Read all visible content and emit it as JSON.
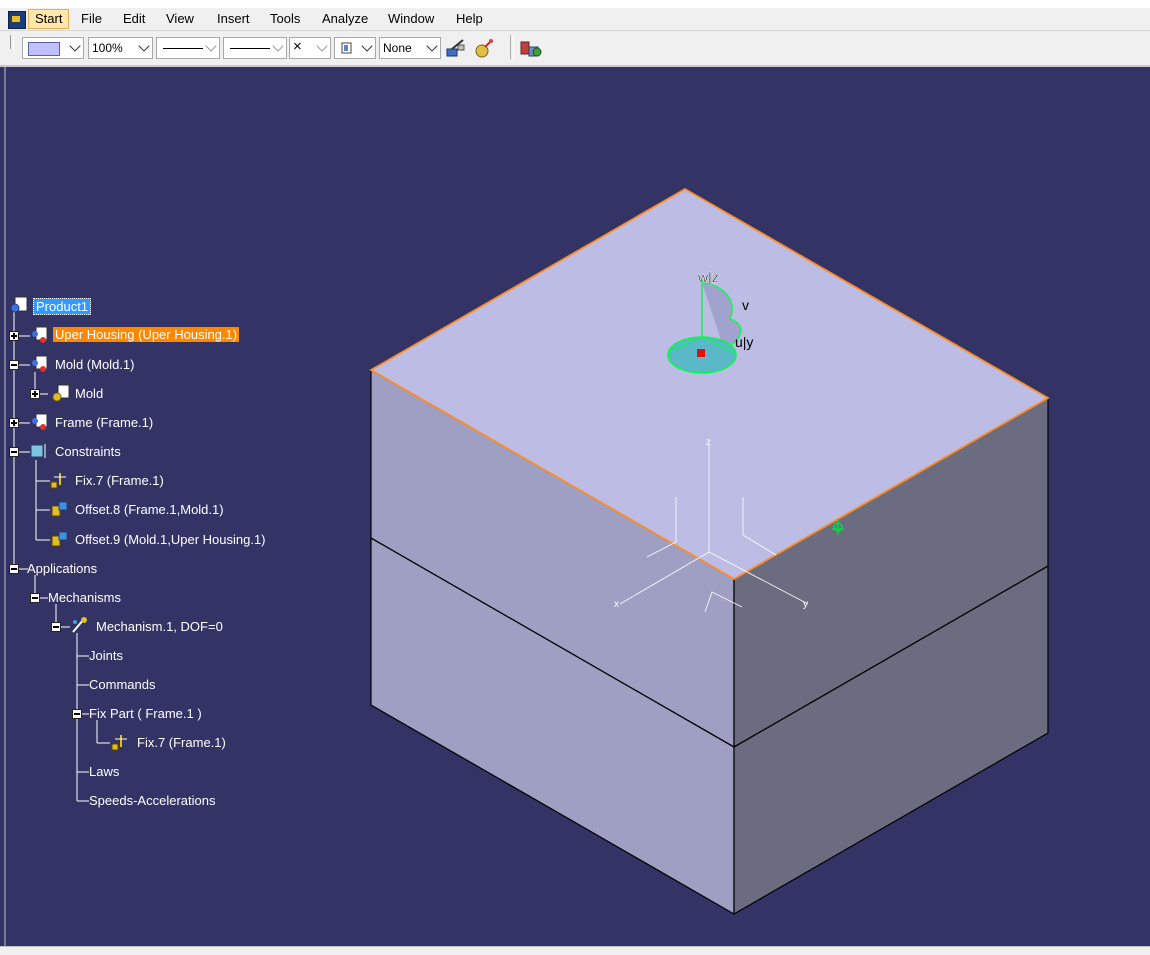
{
  "menubar": {
    "items": [
      "Start",
      "File",
      "Edit",
      "View",
      "Insert",
      "Tools",
      "Analyze",
      "Window",
      "Help"
    ],
    "active": "Start"
  },
  "toolbar": {
    "color_swatch": "#c0c0ff",
    "zoom": "100%",
    "linetype_label": "",
    "lineweight_label": "",
    "point_symbol": "×",
    "layer": "None"
  },
  "tree": {
    "root": "Product1",
    "nodes": {
      "uper_housing": "Uper Housing (Uper Housing.1)",
      "mold_inst": "Mold (Mold.1)",
      "mold_part": "Mold",
      "frame": "Frame (Frame.1)",
      "constraints": "Constraints",
      "fix7": "Fix.7 (Frame.1)",
      "offset8": "Offset.8 (Frame.1,Mold.1)",
      "offset9": "Offset.9 (Mold.1,Uper Housing.1)",
      "applications": "Applications",
      "mechanisms": "Mechanisms",
      "mechanism1": "Mechanism.1, DOF=0",
      "joints": "Joints",
      "commands": "Commands",
      "fix_part": "Fix Part ( Frame.1 )",
      "fix7_sub": "Fix.7 (Frame.1)",
      "laws": "Laws",
      "speeds": "Speeds-Accelerations"
    }
  },
  "viewport": {
    "background": "#333366",
    "top_face_color": "#bcbce4",
    "left_face_color": "#9f9fc4",
    "right_face_color": "#6c6c80",
    "highlight_edge_color": "#ff8c20",
    "compass_labels": {
      "wz": "w|z",
      "v": "v",
      "uy": "u|y"
    },
    "axis_labels": {
      "x": "x",
      "y": "y",
      "z": "z"
    }
  }
}
